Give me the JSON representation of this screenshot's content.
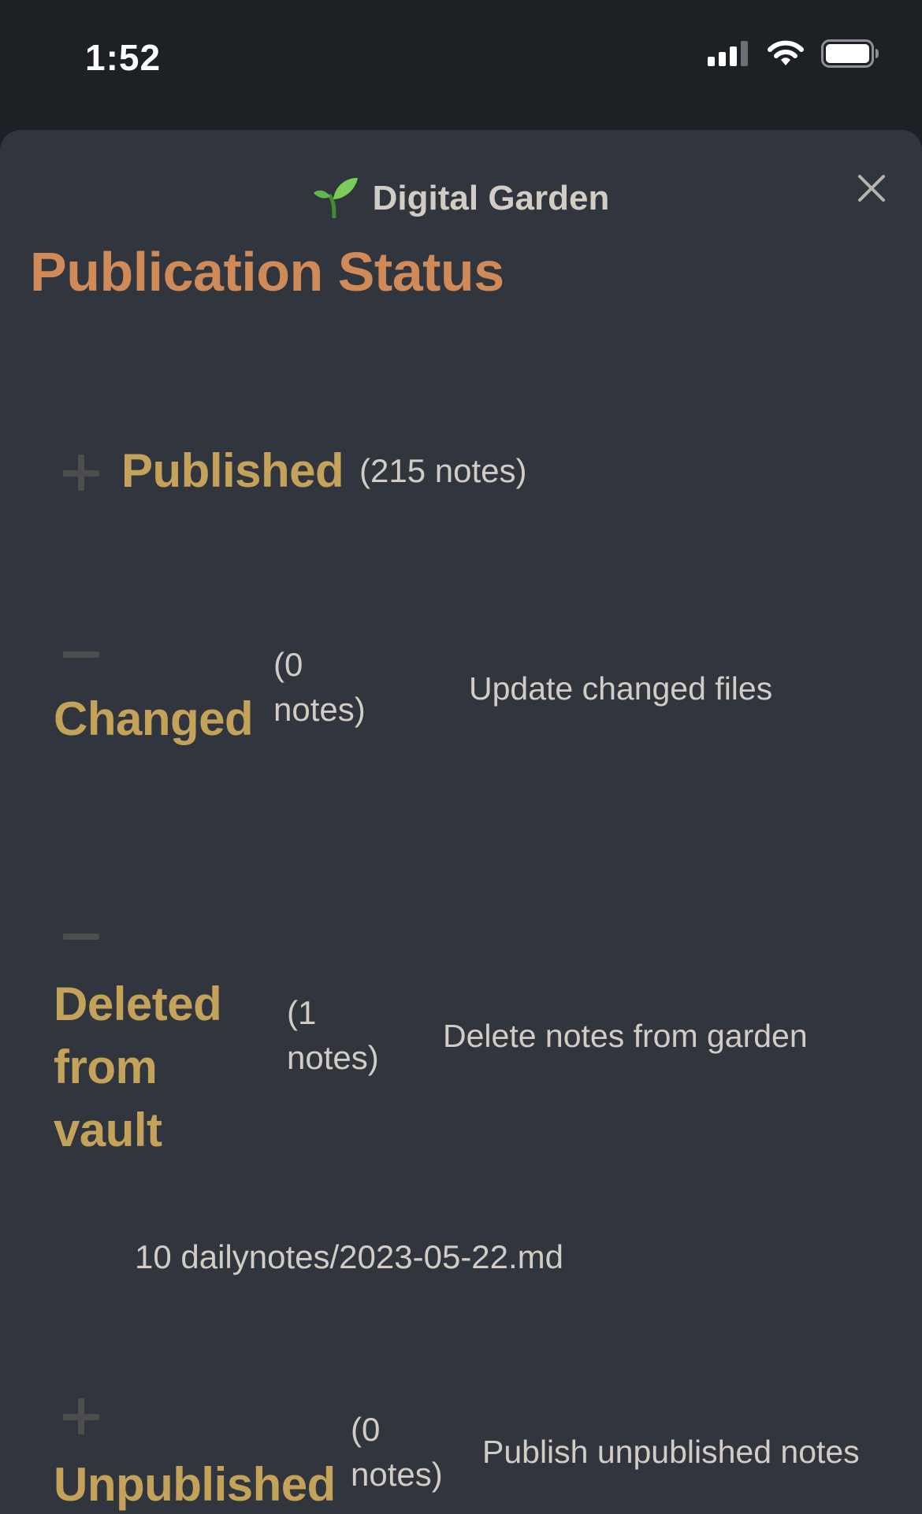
{
  "status_bar": {
    "time": "1:52",
    "icons": [
      "cellular-signal-icon",
      "wifi-icon",
      "battery-icon"
    ]
  },
  "modal": {
    "header_icon": "seedling-icon",
    "title": "Digital Garden",
    "close_icon": "close-icon"
  },
  "page": {
    "title": "Publication Status"
  },
  "sections": {
    "published": {
      "toggle": "plus",
      "label": "Published",
      "count": "(215 notes)"
    },
    "changed": {
      "toggle": "minus",
      "label": "Changed",
      "count_line1": "(0",
      "count_line2": "notes)",
      "action": "Update changed files"
    },
    "deleted": {
      "toggle": "minus",
      "label_line1": "Deleted",
      "label_line2": "from",
      "label_line3": "vault",
      "count_line1": "(1",
      "count_line2": "notes)",
      "action": "Delete notes from garden",
      "files": [
        "10 dailynotes/2023-05-22.md"
      ]
    },
    "unpublished": {
      "toggle": "plus",
      "label": "Unpublished",
      "count_line1": "(0",
      "count_line2": "notes)",
      "action": "Publish unpublished notes"
    }
  },
  "colors": {
    "background": "#1d2024",
    "sheet": "#31363e",
    "title_accent": "#d08a58",
    "section_label": "#c4a25a",
    "text": "#d2ccc4",
    "toggle": "#4d4d4d"
  }
}
